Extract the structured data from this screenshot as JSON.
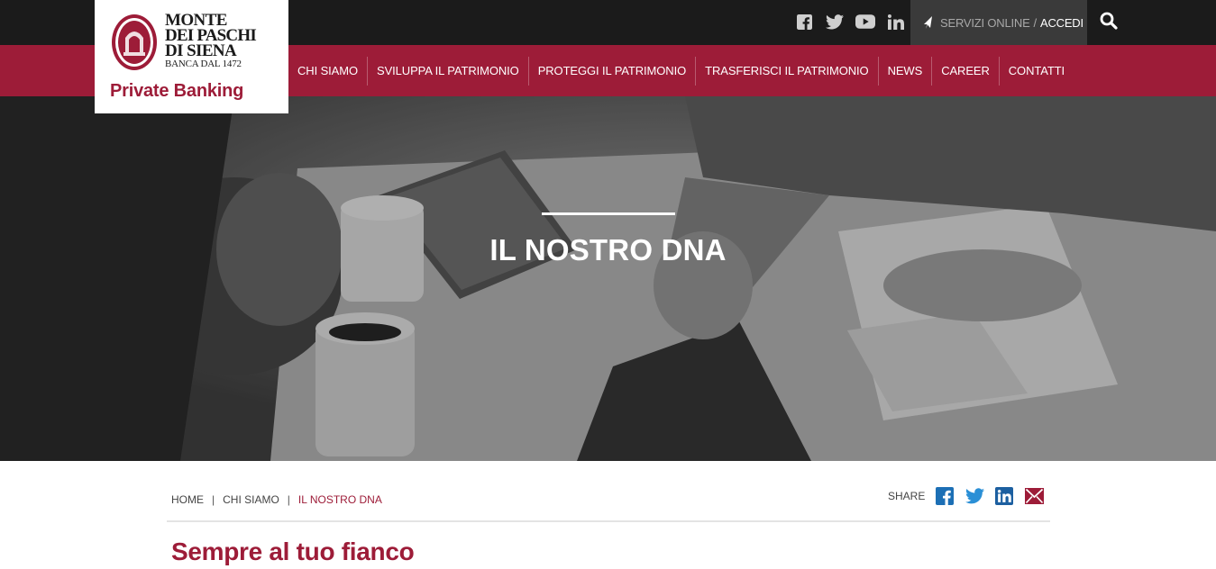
{
  "colors": {
    "brand_red": "#9d1c38",
    "topbar": "#1b1b1b",
    "services_bg": "#3a3a3a"
  },
  "logo": {
    "line1": "MONTE",
    "line2": "DEI PASCHI",
    "line3": "DI SIENA",
    "line4": "BANCA DAL 1472",
    "tagline": "Private Banking"
  },
  "social": [
    "facebook-icon",
    "twitter-icon",
    "youtube-icon",
    "linkedin-icon"
  ],
  "services": {
    "label": "SERVIZI ONLINE",
    "separator": "/",
    "login": "ACCEDI"
  },
  "nav": {
    "items": [
      "CHI SIAMO",
      "SVILUPPA IL PATRIMONIO",
      "PROTEGGI IL PATRIMONIO",
      "TRASFERISCI IL PATRIMONIO",
      "NEWS",
      "CAREER",
      "CONTATTI"
    ]
  },
  "hero": {
    "title": "IL NOSTRO DNA"
  },
  "breadcrumb": {
    "items": [
      "HOME",
      "CHI SIAMO",
      "IL NOSTRO DNA"
    ],
    "separator": "|"
  },
  "share": {
    "label": "SHARE",
    "icons": [
      "facebook-icon",
      "twitter-icon",
      "linkedin-icon",
      "mail-icon"
    ]
  },
  "content": {
    "heading": "Sempre al tuo fianco"
  }
}
